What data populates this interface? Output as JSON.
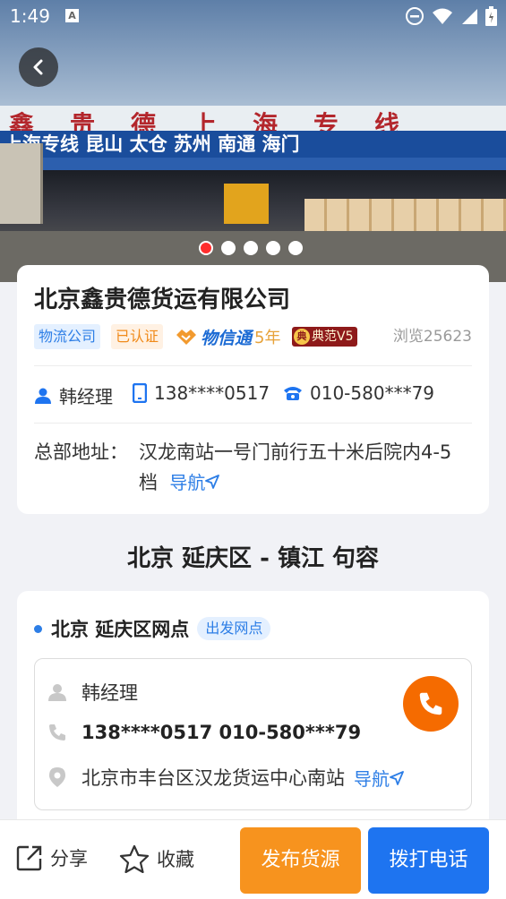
{
  "status_bar": {
    "time": "1:49",
    "notification_glyph": "A"
  },
  "hero": {
    "sign_top": "鑫贵德上海专线",
    "sign_band": "上海专线 昆山 太仓 苏州 南通 海门",
    "carousel_count": 5,
    "carousel_active": 0
  },
  "company": {
    "name": "北京鑫贵德货运有限公司",
    "tag_type": "物流公司",
    "tag_verified": "已认证",
    "wxt_label": "物信通",
    "wxt_years": "5年",
    "dianfan_mark": "典",
    "dianfan_label": "典范V5",
    "views": "浏览25623",
    "contact_name": "韩经理",
    "mobile": "138****0517",
    "phone": "010-580***79",
    "address_label": "总部地址：",
    "address": "汉龙南站一号门前行五十米后院内4-5档",
    "nav_label": "导航"
  },
  "route": {
    "title": "北京 延庆区 - 镇江 句容"
  },
  "branch": {
    "name": "北京 延庆区网点",
    "tag": "出发网点",
    "contact_name": "韩经理",
    "phones": "138****0517 010-580***79",
    "address": "北京市丰台区汉龙货运中心南站",
    "nav_label": "导航"
  },
  "bottom": {
    "share": "分享",
    "favorite": "收藏",
    "publish": "发布货源",
    "call": "拨打电话"
  },
  "colors": {
    "accent_blue": "#1e74f0",
    "accent_orange": "#f7931e",
    "call_orange": "#f56b00"
  }
}
